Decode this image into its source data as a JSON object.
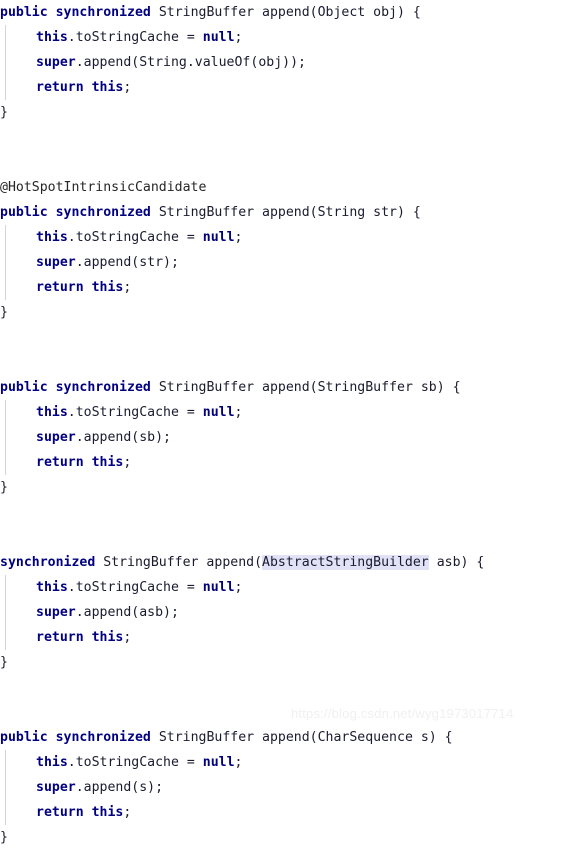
{
  "editor": {
    "language": "java",
    "background_color": "#ffffff",
    "keyword_color": "#000080",
    "text_color": "#1b1b30",
    "annotation_color": "#262626",
    "highlight_color": "#e2e2f7",
    "indent_guide_color": "#d4d4d4"
  },
  "watermark": {
    "text": "https://blog.csdn.net/wyg1973017714",
    "color": "#f0f0f0"
  },
  "code": {
    "lines": [
      {
        "id": "l01",
        "indent": 0,
        "guide": false,
        "tokens": [
          {
            "t": "public",
            "k": "kw"
          },
          {
            "t": " ",
            "k": "plain"
          },
          {
            "t": "synchronized",
            "k": "kw"
          },
          {
            "t": " StringBuffer append(Object obj) {",
            "k": "plain"
          }
        ]
      },
      {
        "id": "l02",
        "indent": 1,
        "guide": true,
        "tokens": [
          {
            "t": "this",
            "k": "kw"
          },
          {
            "t": ".toStringCache = ",
            "k": "plain"
          },
          {
            "t": "null",
            "k": "kw"
          },
          {
            "t": ";",
            "k": "plain"
          }
        ]
      },
      {
        "id": "l03",
        "indent": 1,
        "guide": true,
        "tokens": [
          {
            "t": "super",
            "k": "kw"
          },
          {
            "t": ".append(String.valueOf(obj));",
            "k": "plain"
          }
        ]
      },
      {
        "id": "l04",
        "indent": 1,
        "guide": true,
        "tokens": [
          {
            "t": "return",
            "k": "kw"
          },
          {
            "t": " ",
            "k": "plain"
          },
          {
            "t": "this",
            "k": "kw"
          },
          {
            "t": ";",
            "k": "plain"
          }
        ]
      },
      {
        "id": "l05",
        "indent": 0,
        "guide": false,
        "tokens": [
          {
            "t": "}",
            "k": "plain"
          }
        ]
      },
      {
        "id": "l06",
        "indent": 0,
        "guide": false,
        "tokens": []
      },
      {
        "id": "l07",
        "indent": 0,
        "guide": false,
        "tokens": []
      },
      {
        "id": "l08",
        "indent": 0,
        "guide": false,
        "tokens": [
          {
            "t": "@HotSpotIntrinsicCandidate",
            "k": "anno"
          }
        ]
      },
      {
        "id": "l09",
        "indent": 0,
        "guide": false,
        "tokens": [
          {
            "t": "public",
            "k": "kw"
          },
          {
            "t": " ",
            "k": "plain"
          },
          {
            "t": "synchronized",
            "k": "kw"
          },
          {
            "t": " StringBuffer append(String str) {",
            "k": "plain"
          }
        ]
      },
      {
        "id": "l10",
        "indent": 1,
        "guide": true,
        "tokens": [
          {
            "t": "this",
            "k": "kw"
          },
          {
            "t": ".toStringCache = ",
            "k": "plain"
          },
          {
            "t": "null",
            "k": "kw"
          },
          {
            "t": ";",
            "k": "plain"
          }
        ]
      },
      {
        "id": "l11",
        "indent": 1,
        "guide": true,
        "tokens": [
          {
            "t": "super",
            "k": "kw"
          },
          {
            "t": ".append(str);",
            "k": "plain"
          }
        ]
      },
      {
        "id": "l12",
        "indent": 1,
        "guide": true,
        "tokens": [
          {
            "t": "return",
            "k": "kw"
          },
          {
            "t": " ",
            "k": "plain"
          },
          {
            "t": "this",
            "k": "kw"
          },
          {
            "t": ";",
            "k": "plain"
          }
        ]
      },
      {
        "id": "l13",
        "indent": 0,
        "guide": false,
        "tokens": [
          {
            "t": "}",
            "k": "plain"
          }
        ]
      },
      {
        "id": "l14",
        "indent": 0,
        "guide": false,
        "tokens": []
      },
      {
        "id": "l15",
        "indent": 0,
        "guide": false,
        "tokens": []
      },
      {
        "id": "l16",
        "indent": 0,
        "guide": false,
        "tokens": [
          {
            "t": "public",
            "k": "kw"
          },
          {
            "t": " ",
            "k": "plain"
          },
          {
            "t": "synchronized",
            "k": "kw"
          },
          {
            "t": " StringBuffer append(StringBuffer sb) {",
            "k": "plain"
          }
        ]
      },
      {
        "id": "l17",
        "indent": 1,
        "guide": true,
        "tokens": [
          {
            "t": "this",
            "k": "kw"
          },
          {
            "t": ".toStringCache = ",
            "k": "plain"
          },
          {
            "t": "null",
            "k": "kw"
          },
          {
            "t": ";",
            "k": "plain"
          }
        ]
      },
      {
        "id": "l18",
        "indent": 1,
        "guide": true,
        "tokens": [
          {
            "t": "super",
            "k": "kw"
          },
          {
            "t": ".append(sb);",
            "k": "plain"
          }
        ]
      },
      {
        "id": "l19",
        "indent": 1,
        "guide": true,
        "tokens": [
          {
            "t": "return",
            "k": "kw"
          },
          {
            "t": " ",
            "k": "plain"
          },
          {
            "t": "this",
            "k": "kw"
          },
          {
            "t": ";",
            "k": "plain"
          }
        ]
      },
      {
        "id": "l20",
        "indent": 0,
        "guide": false,
        "tokens": [
          {
            "t": "}",
            "k": "plain"
          }
        ]
      },
      {
        "id": "l21",
        "indent": 0,
        "guide": false,
        "tokens": []
      },
      {
        "id": "l22",
        "indent": 0,
        "guide": false,
        "tokens": []
      },
      {
        "id": "l23",
        "indent": 0,
        "guide": false,
        "tokens": [
          {
            "t": "synchronized",
            "k": "kw"
          },
          {
            "t": " StringBuffer append(",
            "k": "plain"
          },
          {
            "t": "AbstractStringBuilder",
            "k": "plain hl"
          },
          {
            "t": " asb) {",
            "k": "plain"
          }
        ]
      },
      {
        "id": "l24",
        "indent": 1,
        "guide": true,
        "tokens": [
          {
            "t": "this",
            "k": "kw"
          },
          {
            "t": ".toStringCache = ",
            "k": "plain"
          },
          {
            "t": "null",
            "k": "kw"
          },
          {
            "t": ";",
            "k": "plain"
          }
        ]
      },
      {
        "id": "l25",
        "indent": 1,
        "guide": true,
        "tokens": [
          {
            "t": "super",
            "k": "kw"
          },
          {
            "t": ".append(asb);",
            "k": "plain"
          }
        ]
      },
      {
        "id": "l26",
        "indent": 1,
        "guide": true,
        "tokens": [
          {
            "t": "return",
            "k": "kw"
          },
          {
            "t": " ",
            "k": "plain"
          },
          {
            "t": "this",
            "k": "kw"
          },
          {
            "t": ";",
            "k": "plain"
          }
        ]
      },
      {
        "id": "l27",
        "indent": 0,
        "guide": false,
        "tokens": [
          {
            "t": "}",
            "k": "plain"
          }
        ]
      },
      {
        "id": "l28",
        "indent": 0,
        "guide": false,
        "tokens": []
      },
      {
        "id": "l29",
        "indent": 0,
        "guide": false,
        "tokens": []
      },
      {
        "id": "l30",
        "indent": 0,
        "guide": false,
        "tokens": [
          {
            "t": "public",
            "k": "kw"
          },
          {
            "t": " ",
            "k": "plain"
          },
          {
            "t": "synchronized",
            "k": "kw"
          },
          {
            "t": " StringBuffer append(CharSequence s) {",
            "k": "plain"
          }
        ]
      },
      {
        "id": "l31",
        "indent": 1,
        "guide": true,
        "tokens": [
          {
            "t": "this",
            "k": "kw"
          },
          {
            "t": ".toStringCache = ",
            "k": "plain"
          },
          {
            "t": "null",
            "k": "kw"
          },
          {
            "t": ";",
            "k": "plain"
          }
        ]
      },
      {
        "id": "l32",
        "indent": 1,
        "guide": true,
        "tokens": [
          {
            "t": "super",
            "k": "kw"
          },
          {
            "t": ".append(s);",
            "k": "plain"
          }
        ]
      },
      {
        "id": "l33",
        "indent": 1,
        "guide": true,
        "tokens": [
          {
            "t": "return",
            "k": "kw"
          },
          {
            "t": " ",
            "k": "plain"
          },
          {
            "t": "this",
            "k": "kw"
          },
          {
            "t": ";",
            "k": "plain"
          }
        ]
      },
      {
        "id": "l34",
        "indent": 0,
        "guide": false,
        "tokens": [
          {
            "t": "}",
            "k": "plain"
          }
        ]
      }
    ]
  }
}
